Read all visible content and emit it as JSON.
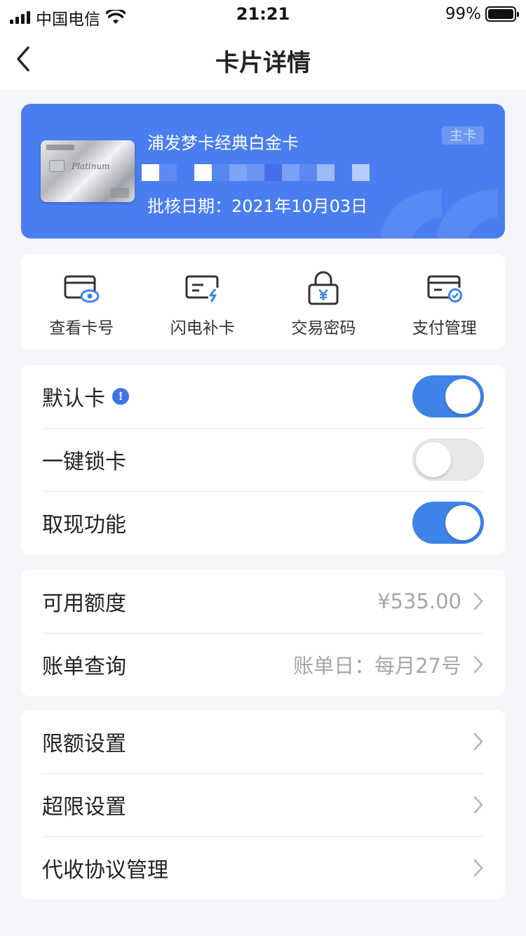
{
  "status_bar": {
    "carrier": "中国电信",
    "time": "21:21",
    "battery": "99%"
  },
  "nav": {
    "title": "卡片详情"
  },
  "card": {
    "name": "浦发梦卡经典白金卡",
    "approval_date": "批核日期：2021年10月03日",
    "badge": "主卡",
    "image_text": "Platinum"
  },
  "actions": [
    {
      "label": "查看卡号",
      "icon": "card-eye-icon"
    },
    {
      "label": "闪电补卡",
      "icon": "card-lightning-icon"
    },
    {
      "label": "交易密码",
      "icon": "lock-yen-icon"
    },
    {
      "label": "支付管理",
      "icon": "card-check-icon"
    }
  ],
  "toggles": [
    {
      "label": "默认卡",
      "on": true,
      "info": "!"
    },
    {
      "label": "一键锁卡",
      "on": false
    },
    {
      "label": "取现功能",
      "on": true
    }
  ],
  "quota": [
    {
      "label": "可用额度",
      "value": "¥535.00"
    },
    {
      "label": "账单查询",
      "value": "账单日：每月27号"
    }
  ],
  "settings": [
    {
      "label": "限额设置"
    },
    {
      "label": "超限设置"
    },
    {
      "label": "代收协议管理"
    }
  ],
  "colors": {
    "accent": "#3e83e7",
    "card_bg": "#4a7ef0",
    "page_bg": "#f4f5f9"
  }
}
